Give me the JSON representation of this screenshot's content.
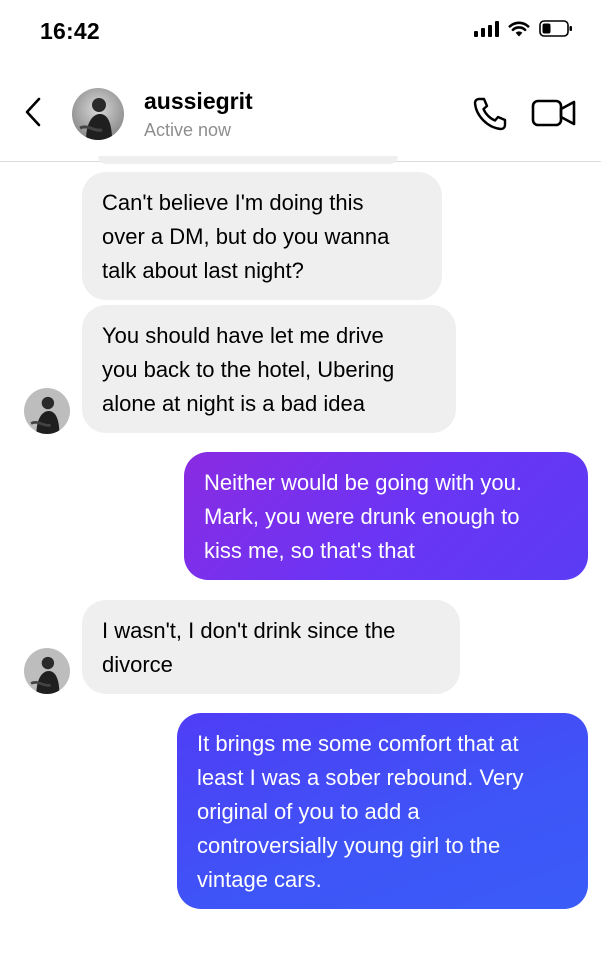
{
  "status_bar": {
    "time": "16:42",
    "icons": [
      "signal-icon",
      "wifi-icon",
      "battery-icon"
    ]
  },
  "header": {
    "back_icon": "chevron-left-icon",
    "contact_name": "aussiegrit",
    "contact_status": "Active now",
    "call_icon": "phone-icon",
    "video_icon": "video-camera-icon"
  },
  "messages": [
    {
      "from": "them",
      "text": "Can't believe I'm doing this\nover a DM, but do you wanna\ntalk about last night?"
    },
    {
      "from": "them",
      "text": "You should have let me drive\nyou back to the hotel, Ubering\nalone at night is a bad idea"
    },
    {
      "from": "me",
      "text": "Neither would be going with you.\nMark, you were drunk enough to\nkiss me, so that's that"
    },
    {
      "from": "them",
      "text": "I wasn't, I don't drink since the\ndivorce"
    },
    {
      "from": "me",
      "text": "It brings me some comfort that at\nleast I was a sober rebound. Very\noriginal of you to add a\ncontroversially young girl to the\nvintage cars."
    }
  ],
  "colors": {
    "received_bubble": "#efefef",
    "sent_gradient_purple": "#7b2ff7",
    "sent_gradient_blue": "#3b5cf8",
    "muted_text": "#8e8e8e",
    "divider": "#dbdbdb"
  }
}
